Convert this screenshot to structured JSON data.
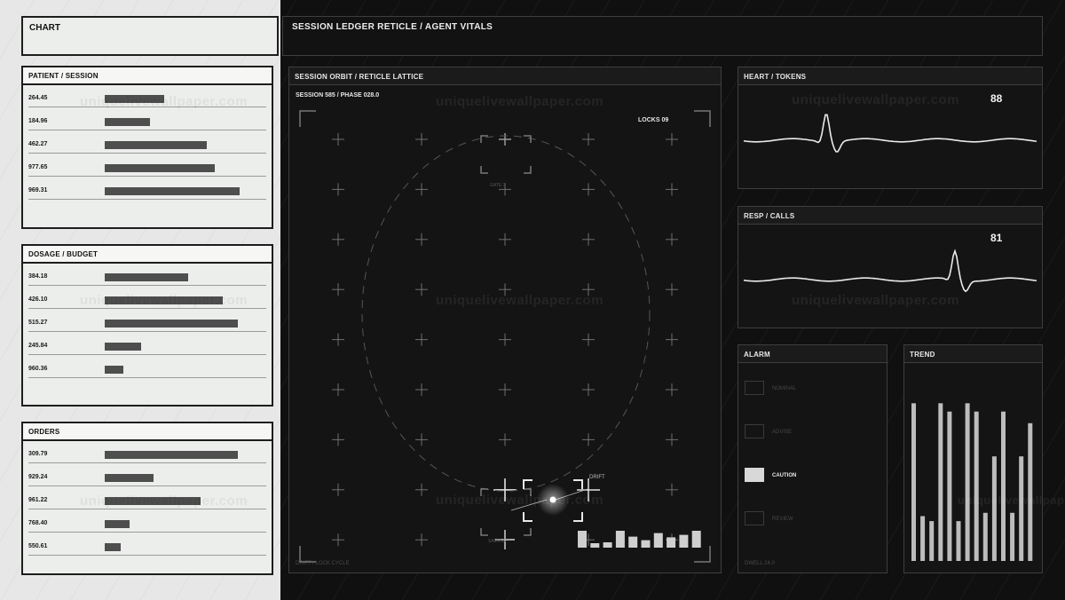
{
  "app": {
    "chart_label": "CHART",
    "title": "SESSION LEDGER RETICLE / AGENT VITALS",
    "watermark": "uniquelivewallpaper.com"
  },
  "left_panels": [
    {
      "title": "PATIENT / SESSION",
      "rows": [
        {
          "value": "264.45",
          "level": 0.29
        },
        {
          "value": "184.96",
          "level": 0.22
        },
        {
          "value": "462.27",
          "level": 0.5
        },
        {
          "value": "977.65",
          "level": 0.54
        },
        {
          "value": "969.31",
          "level": 0.66
        }
      ]
    },
    {
      "title": "DOSAGE / BUDGET",
      "rows": [
        {
          "value": "384.18",
          "level": 0.41
        },
        {
          "value": "426.10",
          "level": 0.58
        },
        {
          "value": "515.27",
          "level": 0.65
        },
        {
          "value": "245.84",
          "level": 0.18
        },
        {
          "value": "960.36",
          "level": 0.09
        }
      ]
    },
    {
      "title": "ORDERS",
      "rows": [
        {
          "value": "309.79",
          "level": 0.65
        },
        {
          "value": "929.24",
          "level": 0.24
        },
        {
          "value": "961.22",
          "level": 0.47
        },
        {
          "value": "768.40",
          "level": 0.12
        },
        {
          "value": "550.61",
          "level": 0.08
        }
      ]
    }
  ],
  "orbit": {
    "title": "SESSION ORBIT / RETICLE LATTICE",
    "session": "SESSION 585 / PHASE 028.0",
    "locks": "LOCKS 09",
    "gate_label": "GATE 3",
    "drift_label": "DRIFT",
    "sample_label": "SAMPLE",
    "footer": "DRIFT / LOCK CYCLE",
    "histogram": [
      0.95,
      0.25,
      0.3,
      0.95,
      0.62,
      0.42,
      0.82,
      0.58,
      0.72,
      0.95
    ]
  },
  "heart": {
    "title": "HEART / TOKENS",
    "value": "88"
  },
  "resp": {
    "title": "RESP / CALLS",
    "value": "81"
  },
  "alarm": {
    "title": "ALARM",
    "items": [
      {
        "label": "NOMINAL",
        "active": false
      },
      {
        "label": "ADVISE",
        "active": false
      },
      {
        "label": "CAUTION",
        "active": true
      },
      {
        "label": "REVIEW",
        "active": false
      }
    ],
    "footer": "DWELL 24.0"
  },
  "trend": {
    "title": "TREND",
    "values": [
      0.95,
      0.27,
      0.24,
      0.95,
      0.9,
      0.24,
      0.95,
      0.9,
      0.29,
      0.63,
      0.9,
      0.29,
      0.63,
      0.83
    ]
  }
}
